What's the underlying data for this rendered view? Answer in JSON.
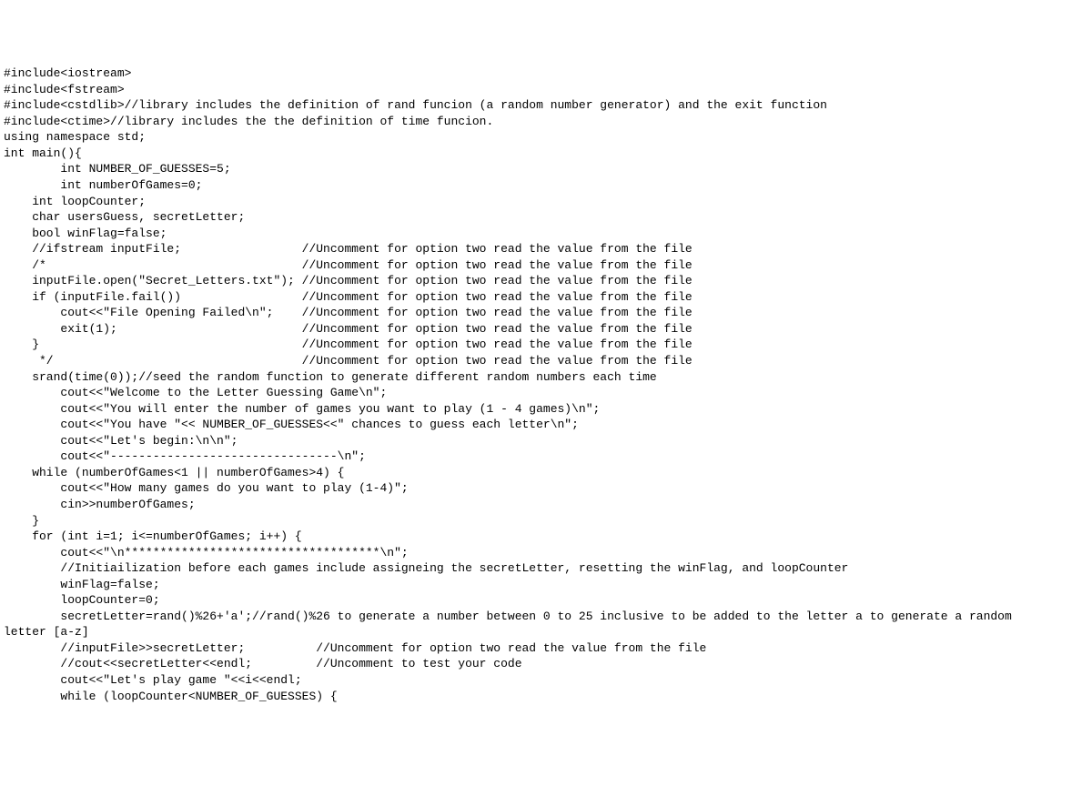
{
  "code": {
    "lines": [
      "#include<iostream>",
      "#include<fstream>",
      "#include<cstdlib>//library includes the definition of rand funcion (a random number generator) and the exit function",
      "#include<ctime>//library includes the the definition of time funcion.",
      "using namespace std;",
      "int main(){",
      "        int NUMBER_OF_GUESSES=5;",
      "        int numberOfGames=0;",
      "    int loopCounter;",
      "    char usersGuess, secretLetter;",
      "    bool winFlag=false;",
      "    //ifstream inputFile;                 //Uncomment for option two read the value from the file",
      "    /*                                    //Uncomment for option two read the value from the file",
      "    inputFile.open(\"Secret_Letters.txt\"); //Uncomment for option two read the value from the file",
      "    if (inputFile.fail())                 //Uncomment for option two read the value from the file",
      "        cout<<\"File Opening Failed\\n\";    //Uncomment for option two read the value from the file",
      "        exit(1);                          //Uncomment for option two read the value from the file",
      "    }                                     //Uncomment for option two read the value from the file",
      "     */                                   //Uncomment for option two read the value from the file",
      "    srand(time(0));//seed the random function to generate different random numbers each time",
      "        cout<<\"Welcome to the Letter Guessing Game\\n\";",
      "        cout<<\"You will enter the number of games you want to play (1 - 4 games)\\n\";",
      "        cout<<\"You have \"<< NUMBER_OF_GUESSES<<\" chances to guess each letter\\n\";",
      "        cout<<\"Let's begin:\\n\\n\";",
      "        cout<<\"--------------------------------\\n\";",
      "    while (numberOfGames<1 || numberOfGames>4) {",
      "        cout<<\"How many games do you want to play (1-4)\";",
      "        cin>>numberOfGames;",
      "    }",
      "    for (int i=1; i<=numberOfGames; i++) {",
      "        cout<<\"\\n************************************\\n\";",
      "        //Initiailization before each games include assigneing the secretLetter, resetting the winFlag, and loopCounter",
      "        winFlag=false;",
      "        loopCounter=0;",
      "        secretLetter=rand()%26+'a';//rand()%26 to generate a number between 0 to 25 inclusive to be added to the letter a to generate a random",
      "letter [a-z]",
      "        //inputFile>>secretLetter;          //Uncomment for option two read the value from the file",
      "        //cout<<secretLetter<<endl;         //Uncomment to test your code",
      "        cout<<\"Let's play game \"<<i<<endl;",
      "        while (loopCounter<NUMBER_OF_GUESSES) {"
    ]
  }
}
